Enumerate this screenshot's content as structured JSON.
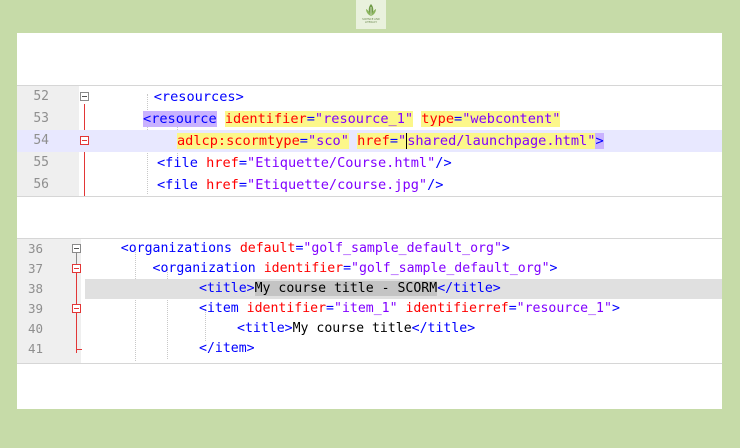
{
  "brand": {
    "logo_text": "SCIENCE AND LITERACY"
  },
  "panel1": {
    "lines": [
      {
        "num": "52",
        "indent": "    ",
        "parts": [
          [
            "tag",
            "<resources>"
          ]
        ]
      },
      {
        "num": "53",
        "indent": "        ",
        "parts": [
          [
            "tag",
            "<"
          ],
          [
            "tag",
            "resource"
          ],
          [
            "txt",
            " "
          ],
          [
            "attr",
            "identifier"
          ],
          [
            "tag",
            "="
          ],
          [
            "val",
            "\"resource_1\""
          ],
          [
            "txt",
            " "
          ],
          [
            "attr",
            "type"
          ],
          [
            "tag",
            "="
          ],
          [
            "val",
            "\"webcontent\""
          ]
        ]
      },
      {
        "num": "54",
        "indent": "        ",
        "parts": [
          [
            "attr",
            "adlcp:scormtype"
          ],
          [
            "tag",
            "="
          ],
          [
            "val",
            "\"sco\""
          ],
          [
            "txt",
            " "
          ],
          [
            "attr",
            "href"
          ],
          [
            "tag",
            "="
          ],
          [
            "val",
            "\""
          ],
          [
            "val",
            "shared/launchpage.html\""
          ],
          [
            "tag",
            ">"
          ]
        ]
      },
      {
        "num": "55",
        "indent": "      ",
        "parts": [
          [
            "tag",
            "<file "
          ],
          [
            "attr",
            "href"
          ],
          [
            "tag",
            "="
          ],
          [
            "val",
            "\"Etiquette/Course.html\""
          ],
          [
            "tag",
            "/>"
          ]
        ]
      },
      {
        "num": "56",
        "indent": "      ",
        "parts": [
          [
            "tag",
            "<file "
          ],
          [
            "attr",
            "href"
          ],
          [
            "tag",
            "="
          ],
          [
            "val",
            "\"Etiquette/course.jpg\""
          ],
          [
            "tag",
            "/>"
          ]
        ]
      }
    ]
  },
  "panel2": {
    "lines": [
      {
        "num": "36",
        "indent": "    ",
        "parts": [
          [
            "tag",
            "<organizations "
          ],
          [
            "attr",
            "default"
          ],
          [
            "tag",
            "="
          ],
          [
            "val",
            "\"golf_sample_default_org\""
          ],
          [
            "tag",
            ">"
          ]
        ]
      },
      {
        "num": "37",
        "indent": "        ",
        "parts": [
          [
            "tag",
            "<organization "
          ],
          [
            "attr",
            "identifier"
          ],
          [
            "tag",
            "="
          ],
          [
            "val",
            "\"golf_sample_default_org\""
          ],
          [
            "tag",
            ">"
          ]
        ]
      },
      {
        "num": "38",
        "indent": "            ",
        "parts": [
          [
            "tag",
            "<title>"
          ],
          [
            "txt",
            "My course title - SCORM"
          ],
          [
            "tag",
            "</title>"
          ]
        ]
      },
      {
        "num": "39",
        "indent": "            ",
        "parts": [
          [
            "tag",
            "<item "
          ],
          [
            "attr",
            "identifier"
          ],
          [
            "tag",
            "="
          ],
          [
            "val",
            "\"item_1\""
          ],
          [
            "txt",
            " "
          ],
          [
            "attr",
            "identifierref"
          ],
          [
            "tag",
            "="
          ],
          [
            "val",
            "\"resource_1\""
          ],
          [
            "tag",
            ">"
          ]
        ]
      },
      {
        "num": "40",
        "indent": "                ",
        "parts": [
          [
            "tag",
            "<title>"
          ],
          [
            "txt",
            "My course title"
          ],
          [
            "tag",
            "</title>"
          ]
        ]
      },
      {
        "num": "41",
        "indent": "            ",
        "parts": [
          [
            "tag",
            "</item>"
          ]
        ]
      }
    ]
  }
}
